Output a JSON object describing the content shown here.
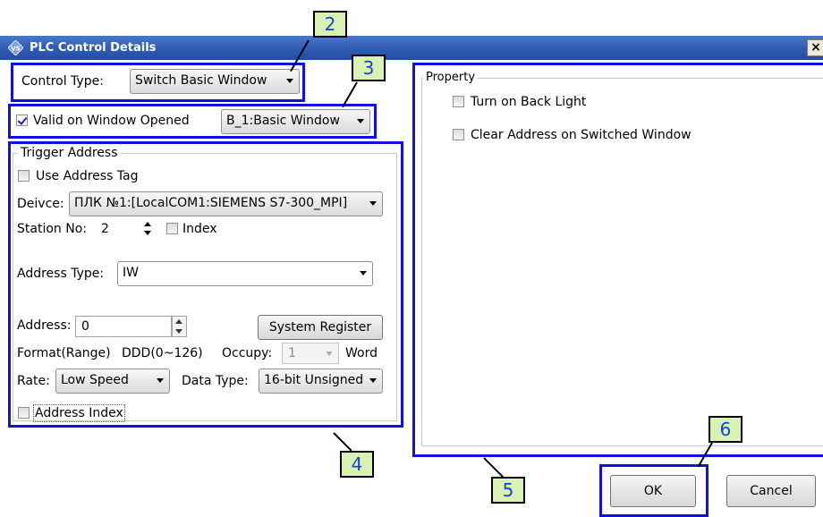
{
  "window": {
    "title": "PLC Control Details",
    "close_glyph": "×"
  },
  "control_type": {
    "label": "Control Type:",
    "value": "Switch Basic Window"
  },
  "valid_on_window": {
    "label": "Valid on Window Opened",
    "checked": true,
    "window_value": "B_1:Basic Window"
  },
  "trigger": {
    "group_label": "Trigger Address",
    "use_address_tag": "Use Address Tag",
    "device_label": "Deivce:",
    "device_value": "ПЛК №1:[LocalCOM1:SIEMENS S7-300_MPI]",
    "station_label": "Station No:",
    "station_value": "2",
    "index_label": "Index",
    "address_type_label": "Address Type:",
    "address_type_value": "IW",
    "address_label": "Address:",
    "address_value": "0",
    "system_register": "System Register",
    "format_label": "Format(Range)",
    "format_value": "DDD(0~126)",
    "occupy_label": "Occupy:",
    "occupy_value": "1",
    "occupy_unit": "Word",
    "rate_label": "Rate:",
    "rate_value": "Low Speed",
    "data_type_label": "Data Type:",
    "data_type_value": "16-bit Unsigned",
    "address_index": "Address Index"
  },
  "property": {
    "group_label": "Property",
    "items": [
      "Turn on Back Light",
      "Clear Address on Switched Window"
    ]
  },
  "buttons": {
    "ok": "OK",
    "cancel": "Cancel"
  },
  "callouts": [
    "2",
    "3",
    "4",
    "5",
    "6"
  ],
  "colors": {
    "highlight": "#1111dd",
    "callout_fill": "#d8f2b4",
    "callout_text": "#1a3fd6",
    "titlebar": "#2f5db5"
  }
}
